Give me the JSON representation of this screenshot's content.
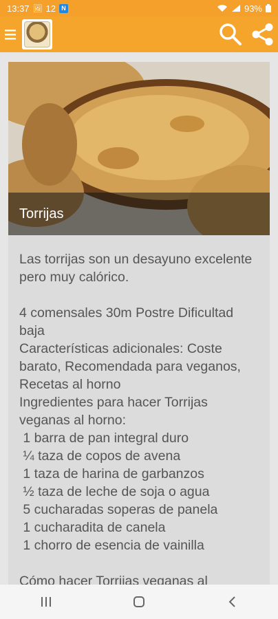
{
  "status": {
    "time": "13:37",
    "notif_count": "12",
    "battery": "93%"
  },
  "appbar": {
    "menu_icon": "hamburger-icon",
    "search_icon": "search-icon",
    "share_icon": "share-icon"
  },
  "recipe": {
    "title": "Torrijas",
    "body": "Las torrijas son un desayuno excelente pero muy calórico.\n\n4 comensales 30m Postre Dificultad baja\nCaracterísticas adicionales: Coste barato, Recomendada para veganos, Recetas al horno\nIngredientes para hacer Torrijas veganas al horno:\n 1 barra de pan integral duro\n ¼ taza de copos de avena\n 1 taza de harina de garbanzos\n ½ taza de leche de soja o agua\n 5 cucharadas soperas de panela\n 1 cucharadita de canela\n 1 chorro de esencia de vainilla\n\nCómo hacer Torrijas veganas al"
  },
  "colors": {
    "accent": "#f6a52c",
    "card_bg": "#dcdcdc",
    "text": "#555555"
  }
}
